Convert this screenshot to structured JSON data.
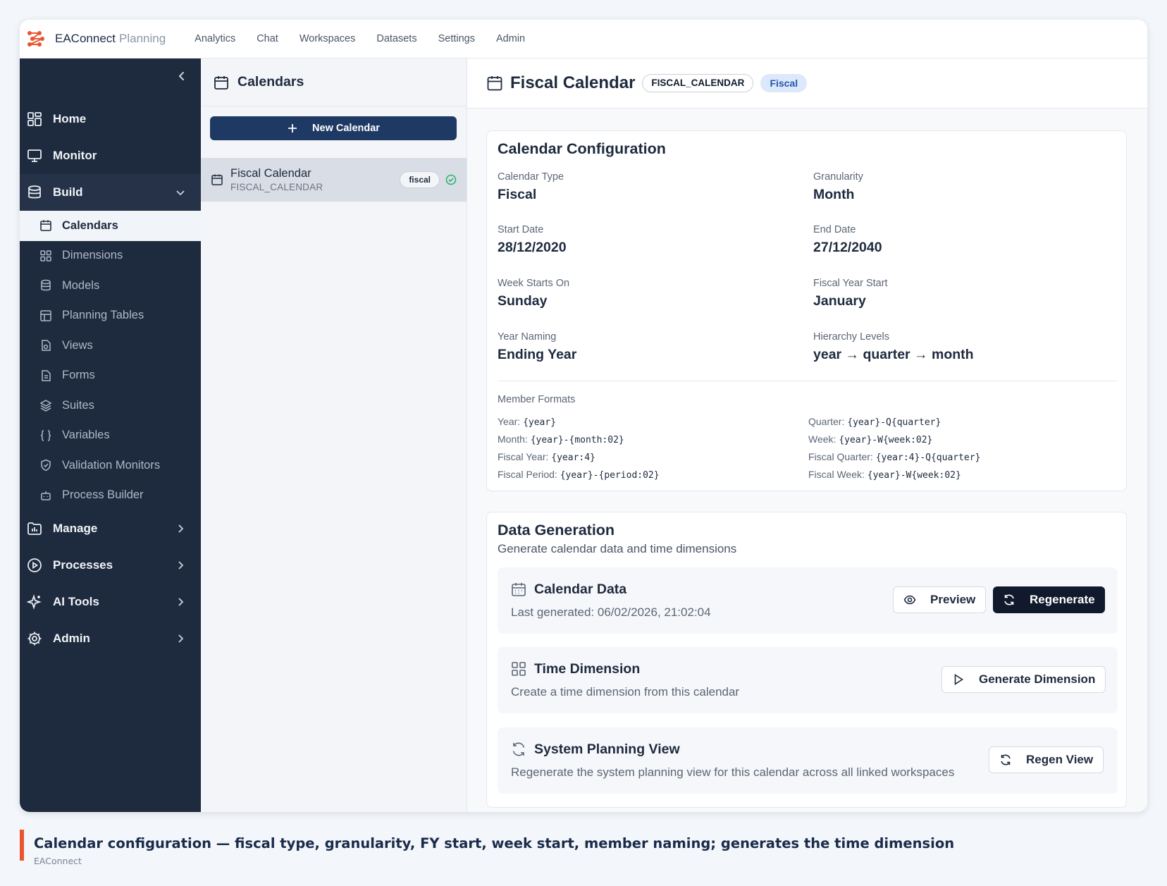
{
  "app": {
    "brand_primary": "EAConnect",
    "brand_secondary": "Planning",
    "accent_color": "#e8552f"
  },
  "topnav": [
    "Analytics",
    "Chat",
    "Workspaces",
    "Datasets",
    "Settings",
    "Admin"
  ],
  "sidebar": {
    "home": "Home",
    "monitor": "Monitor",
    "build": "Build",
    "build_items": [
      "Calendars",
      "Dimensions",
      "Models",
      "Planning Tables",
      "Views",
      "Forms",
      "Suites",
      "Variables",
      "Validation Monitors",
      "Process Builder"
    ],
    "manage": "Manage",
    "processes": "Processes",
    "ai_tools": "AI Tools",
    "admin": "Admin"
  },
  "list": {
    "title": "Calendars",
    "new_button": "New Calendar",
    "item": {
      "name": "Fiscal Calendar",
      "code": "FISCAL_CALENDAR",
      "badge": "fiscal"
    }
  },
  "detail": {
    "title": "Fiscal Calendar",
    "code_tag": "FISCAL_CALENDAR",
    "type_tag": "Fiscal",
    "config": {
      "title": "Calendar Configuration",
      "calendar_type_label": "Calendar Type",
      "calendar_type": "Fiscal",
      "granularity_label": "Granularity",
      "granularity": "Month",
      "start_date_label": "Start Date",
      "start_date": "28/12/2020",
      "end_date_label": "End Date",
      "end_date": "27/12/2040",
      "week_start_label": "Week Starts On",
      "week_start": "Sunday",
      "fy_start_label": "Fiscal Year Start",
      "fy_start": "January",
      "year_naming_label": "Year Naming",
      "year_naming": "Ending Year",
      "hierarchy_label": "Hierarchy Levels",
      "hierarchy": "year → quarter → month",
      "member_formats_title": "Member Formats",
      "formats": {
        "year_label": "Year:",
        "year": "{year}",
        "quarter_label": "Quarter:",
        "quarter": "{year}-Q{quarter}",
        "month_label": "Month:",
        "month": "{year}-{month:02}",
        "week_label": "Week:",
        "week": "{year}-W{week:02}",
        "fiscal_year_label": "Fiscal Year:",
        "fiscal_year": "{year:4}",
        "fiscal_quarter_label": "Fiscal Quarter:",
        "fiscal_quarter": "{year:4}-Q{quarter}",
        "fiscal_period_label": "Fiscal Period:",
        "fiscal_period": "{year}-{period:02}",
        "fiscal_week_label": "Fiscal Week:",
        "fiscal_week": "{year}-W{week:02}"
      }
    },
    "generation": {
      "title": "Data Generation",
      "subtitle": "Generate calendar data and time dimensions",
      "calendar_data": {
        "title": "Calendar Data",
        "status": "Last generated: 06/02/2026, 21:02:04",
        "preview": "Preview",
        "regenerate": "Regenerate"
      },
      "time_dimension": {
        "title": "Time Dimension",
        "desc": "Create a time dimension from this calendar",
        "button": "Generate Dimension"
      },
      "planning_view": {
        "title": "System Planning View",
        "desc": "Regenerate the system planning view for this calendar across all linked workspaces",
        "button": "Regen View"
      }
    }
  },
  "caption": {
    "text": "Calendar configuration — fiscal type, granularity, FY start, week start, member naming; generates the time dimension",
    "source": "EAConnect"
  }
}
